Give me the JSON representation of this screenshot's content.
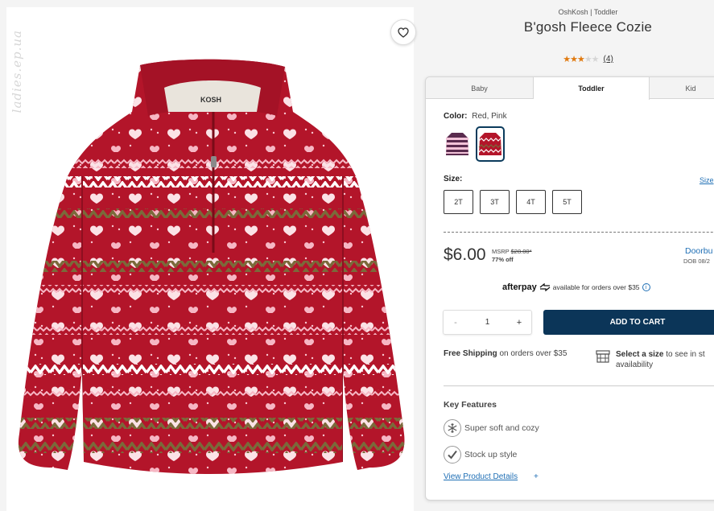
{
  "watermark": "ladies.ep.ua",
  "product": {
    "brand_line": "OshKosh | Toddler",
    "title": "B'gosh Fleece Cozie",
    "rating": 2.5,
    "reviews_text": "(4)"
  },
  "tabs": [
    {
      "label": "Baby"
    },
    {
      "label": "Toddler",
      "active": true
    },
    {
      "label": "Kid"
    }
  ],
  "color": {
    "label": "Color:",
    "value": "Red, Pink",
    "swatches": [
      {
        "name": "stripe-purple-swatch",
        "selected": false
      },
      {
        "name": "red-pink-swatch",
        "selected": true
      }
    ]
  },
  "size": {
    "label": "Size:",
    "chart_link": "Size",
    "options": [
      "2T",
      "3T",
      "4T",
      "5T"
    ]
  },
  "pricing": {
    "price": "$6.00",
    "msrp_label": "MSRP",
    "msrp_value": "$28.00*",
    "discount": "77% off",
    "deal_title": "Doorbu",
    "deal_date": "DOB 08/2"
  },
  "afterpay": {
    "logo": "afterpay",
    "text": "available for orders over $35"
  },
  "quantity": {
    "minus": "-",
    "value": "1",
    "plus": "+"
  },
  "add_to_cart_label": "ADD TO CART",
  "shipping": {
    "bold": "Free Shipping",
    "rest": "on orders over $35"
  },
  "store": {
    "bold": "Select a size",
    "rest": "to see in st",
    "line2": "availability"
  },
  "key_features": {
    "title": "Key Features",
    "items": [
      "Super soft and cozy",
      "Stock up style"
    ],
    "view_details": "View Product Details",
    "view_plus": "+"
  },
  "colors": {
    "navy": "#0b3558",
    "link": "#1f6fb5",
    "star": "#e07a10",
    "sweater_red": "#b3152a"
  }
}
